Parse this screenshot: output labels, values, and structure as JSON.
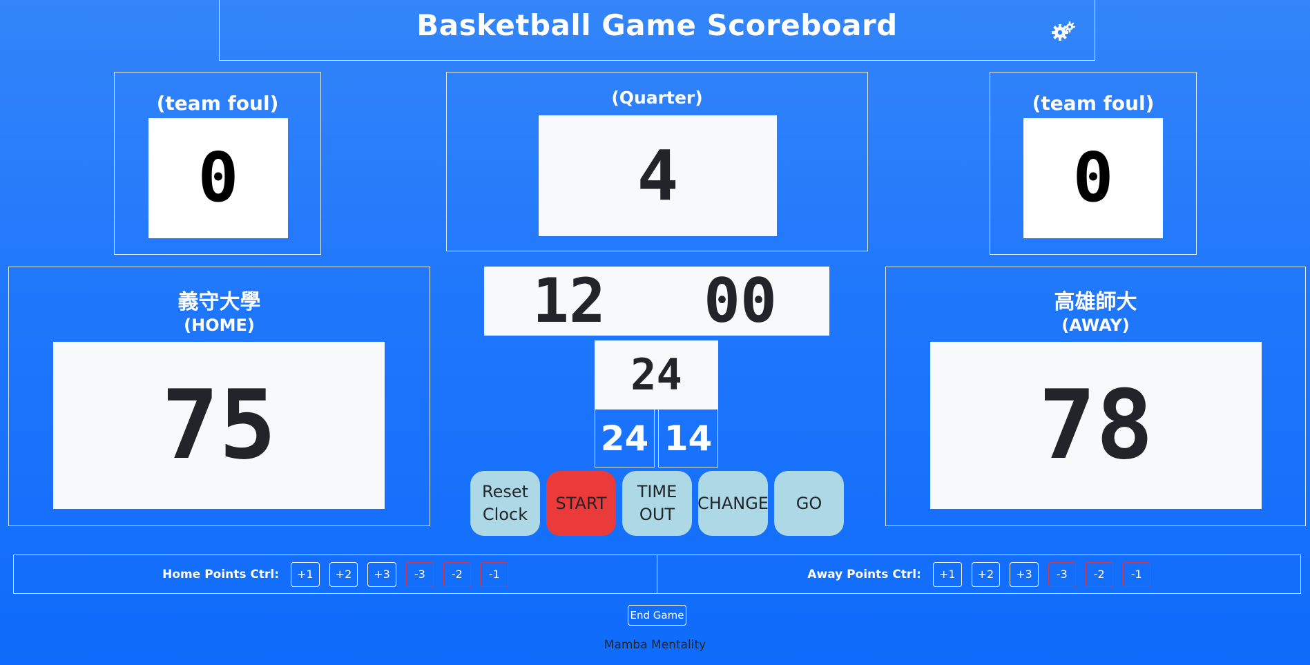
{
  "header": {
    "title": "Basketball Game Scoreboard",
    "settings_icon": "gears-icon"
  },
  "home_foul": {
    "label": "(team foul)",
    "value": "0"
  },
  "quarter": {
    "label": "(Quarter)",
    "value": "4"
  },
  "away_foul": {
    "label": "(team foul)",
    "value": "0"
  },
  "home": {
    "name": "義守大學",
    "tag": "(HOME)",
    "score": "75"
  },
  "away": {
    "name": "高雄師大",
    "tag": "(AWAY)",
    "score": "78"
  },
  "clock": {
    "minutes": "12",
    "seconds": "00"
  },
  "shot_clock": {
    "value": "24",
    "preset_a": "24",
    "preset_b": "14"
  },
  "buttons": {
    "reset_line1": "Reset",
    "reset_line2": "Clock",
    "start": "START",
    "timeout_line1": "TIME",
    "timeout_line2": "OUT",
    "change": "CHANGE",
    "go": "GO"
  },
  "home_ctrl": {
    "label": "Home Points Ctrl:",
    "buttons": [
      "+1",
      "+2",
      "+3",
      "-3",
      "-2",
      "-1"
    ]
  },
  "away_ctrl": {
    "label": "Away Points Ctrl:",
    "buttons": [
      "+1",
      "+2",
      "+3",
      "-3",
      "-2",
      "-1"
    ]
  },
  "end_game": "End Game",
  "footer": "Mamba Mentality",
  "colors": {
    "background": "#1f77fb",
    "start": "#eb3a3a",
    "round_button": "#add8e6",
    "minus_border": "#dc3545"
  }
}
